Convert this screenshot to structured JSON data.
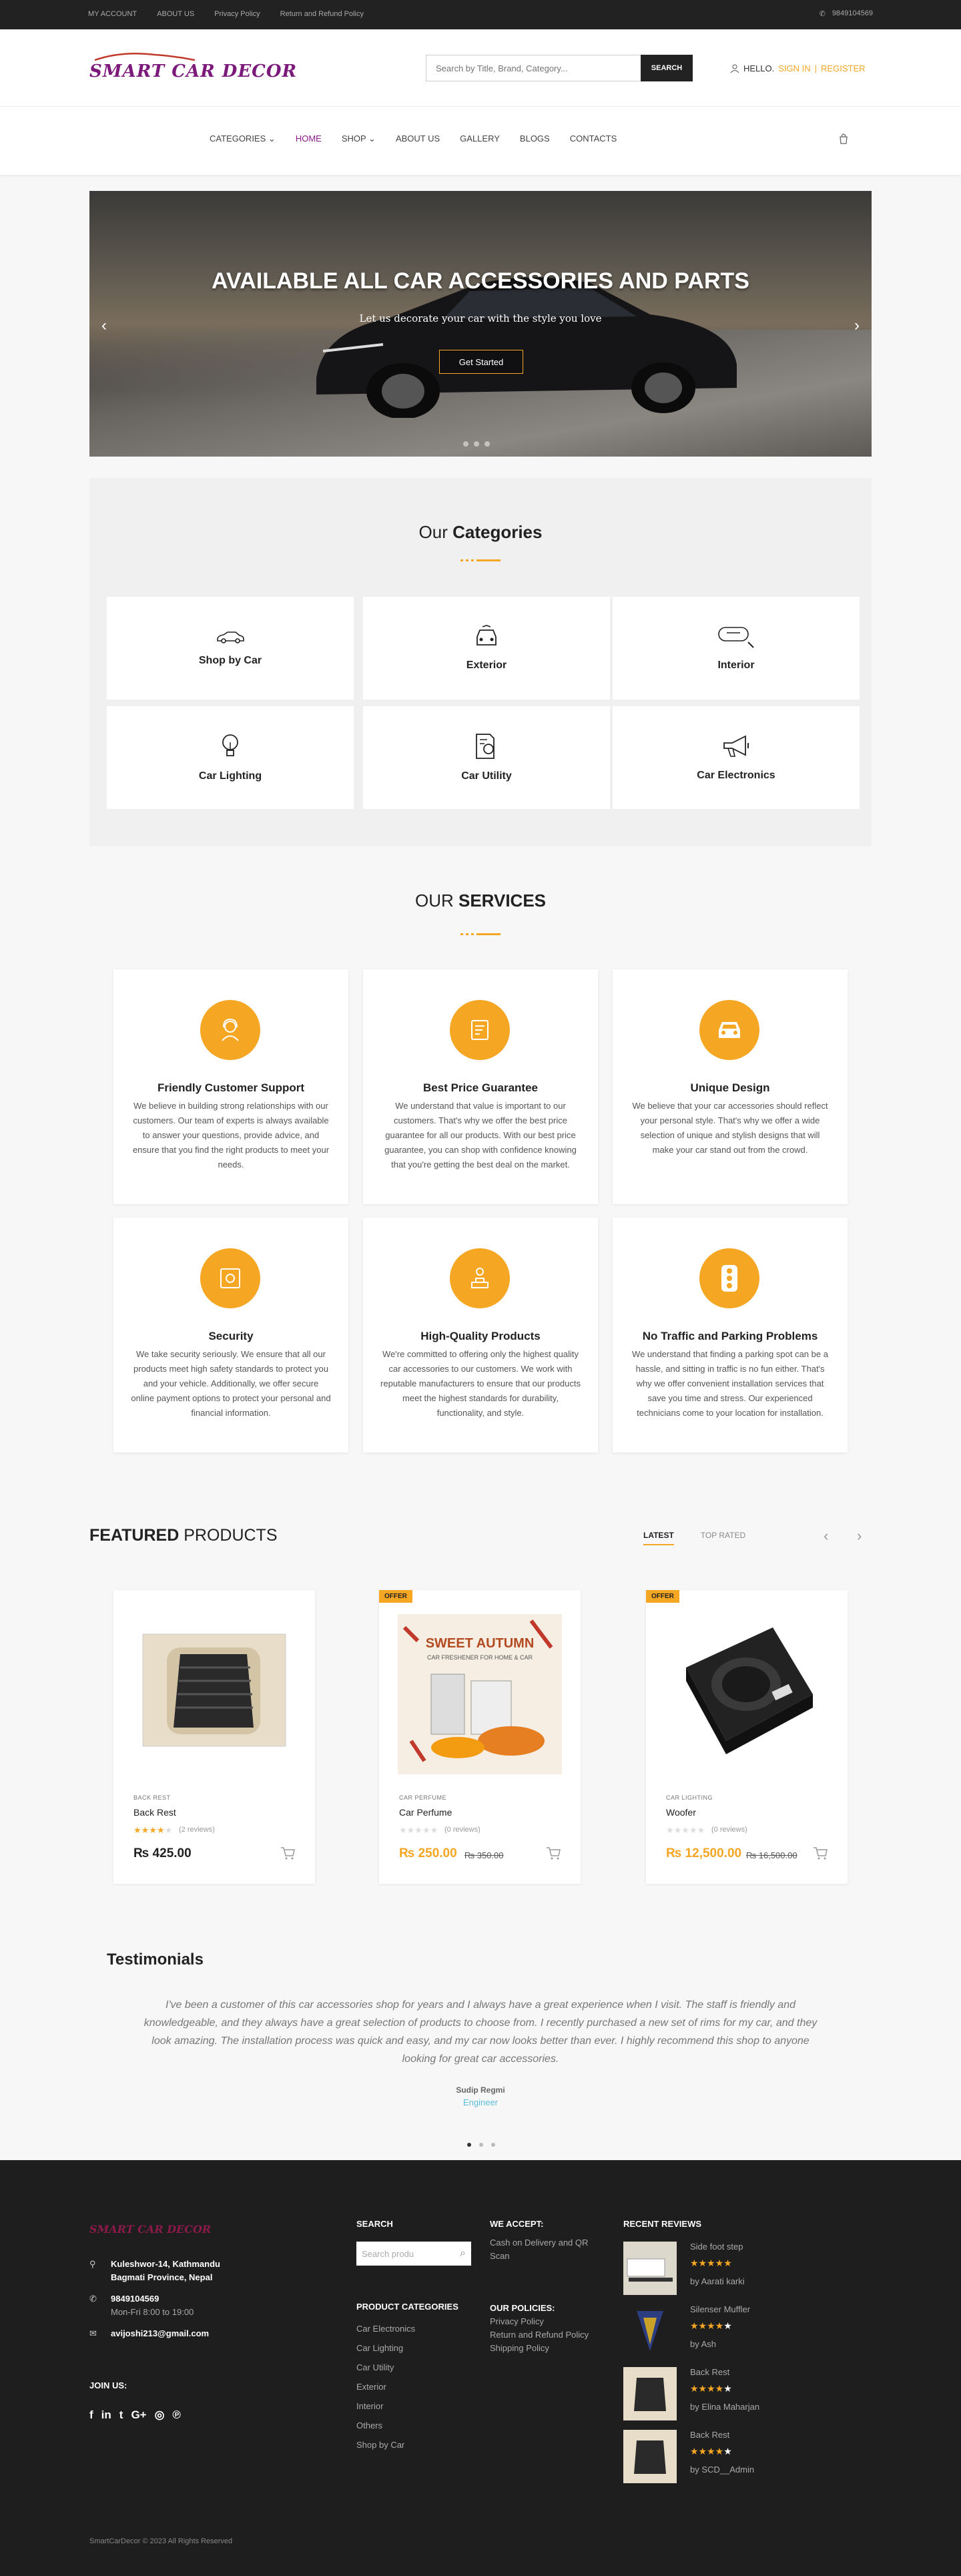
{
  "topbar": {
    "links": [
      "MY ACCOUNT",
      "ABOUT US",
      "Privacy Policy",
      "Return and Refund Policy"
    ],
    "phone": "9849104569"
  },
  "header": {
    "logo": "SMART CAR DECOR",
    "search_placeholder": "Search by Title, Brand, Category...",
    "search_button": "SEARCH",
    "hello": "HELLO.",
    "signin": "SIGN IN",
    "sep": "|",
    "register": "REGISTER"
  },
  "nav": {
    "items": [
      "CATEGORIES",
      "HOME",
      "SHOP",
      "ABOUT US",
      "GALLERY",
      "BLOGS",
      "CONTACTS"
    ],
    "active": "HOME"
  },
  "hero": {
    "title": "AVAILABLE ALL CAR ACCESSORIES AND PARTS",
    "subtitle": "Let us decorate your car with the style you love",
    "cta": "Get Started",
    "prev": "‹",
    "next": "›"
  },
  "categories": {
    "title_a": "Our",
    "title_b": "Categories",
    "items": [
      "Shop by Car",
      "Exterior",
      "Interior",
      "Car Lighting",
      "Car Utility",
      "Car Electronics"
    ]
  },
  "services": {
    "title_a": "OUR",
    "title_b": "SERVICES",
    "items": [
      {
        "title": "Friendly Customer Support",
        "text": "We believe in building strong relationships with our customers. Our team of experts is always available to answer your questions, provide advice, and ensure that you find the right products to meet your needs."
      },
      {
        "title": "Best Price Guarantee",
        "text": "We understand that value is important to our customers. That's why we offer the best price guarantee for all our products. With our best price guarantee, you can shop with confidence knowing that you're getting the best deal on the market."
      },
      {
        "title": "Unique Design",
        "text": "We believe that your car accessories should reflect your personal style. That's why we offer a wide selection of unique and stylish designs that will make your car stand out from the crowd."
      },
      {
        "title": "Security",
        "text": "We take security seriously. We ensure that all our products meet high safety standards to protect you and your vehicle. Additionally, we offer secure online payment options to protect your personal and financial information."
      },
      {
        "title": "High-Quality Products",
        "text": "We're committed to offering only the highest quality car accessories to our customers. We work with reputable manufacturers to ensure that our products meet the highest standards for durability, functionality, and style."
      },
      {
        "title": "No Traffic and Parking Problems",
        "text": "We understand that finding a parking spot can be a hassle, and sitting in traffic is no fun either. That's why we offer convenient installation services that save you time and stress. Our experienced technicians come to your location for installation."
      }
    ]
  },
  "featured": {
    "title_a": "FEATURED",
    "title_b": "PRODUCTS",
    "tabs": [
      "LATEST",
      "TOP RATED"
    ],
    "prev": "‹",
    "next": "›",
    "products": [
      {
        "category": "BACK REST",
        "name": "Back Rest",
        "rating": 4,
        "reviews": "(2 reviews)",
        "price": "₨ 425.00",
        "old": "",
        "offer": ""
      },
      {
        "category": "CAR PERFUME",
        "name": "Car Perfume",
        "rating": 0,
        "reviews": "(0 reviews)",
        "price": "₨ 250.00",
        "old": "₨ 350.00",
        "offer": "OFFER",
        "img_title": "SWEET AUTUMN",
        "img_sub": "CAR FRESHENER FOR HOME & CAR"
      },
      {
        "category": "CAR LIGHTING",
        "name": "Woofer",
        "rating": 0,
        "reviews": "(0 reviews)",
        "price": "₨ 12,500.00",
        "old": "₨ 16,500.00",
        "offer": "OFFER"
      }
    ]
  },
  "testimonials": {
    "title": "Testimonials",
    "quote": "I've been a customer of this car accessories shop for years and I always have a great experience when I visit. The staff is friendly and knowledgeable, and they always have a great selection of products to choose from. I recently purchased a new set of rims for my car, and they look amazing. The installation process was quick and easy, and my car now looks better than ever. I highly recommend this shop to anyone looking for great car accessories.",
    "author": "Sudip Regmi",
    "role": "Engineer"
  },
  "footer": {
    "logo": "SMART CAR DECOR",
    "address1": "Kuleshwor-14, Kathmandu",
    "address2": "Bagmati Province, Nepal",
    "phone": "9849104569",
    "hours": "Mon-Fri 8:00 to 19:00",
    "email": "avijoshi213@gmail.com",
    "join": "JOIN US:",
    "social": [
      "f",
      "in",
      "t",
      "G+",
      "◎",
      "℗"
    ],
    "search_h": "SEARCH",
    "search_placeholder": "Search produ",
    "pc_h": "PRODUCT CATEGORIES",
    "pc": [
      "Car Electronics",
      "Car Lighting",
      "Car Utility",
      "Exterior",
      "Interior",
      "Others",
      "Shop by Car"
    ],
    "accept_h": "WE ACCEPT:",
    "accept": [
      "Cash on Delivery and QR",
      "Scan"
    ],
    "policies_h": "OUR POLICIES:",
    "policies": [
      "Privacy Policy",
      "Return and Refund Policy",
      "Shipping Policy"
    ],
    "reviews_h": "RECENT REVIEWS",
    "reviews": [
      {
        "t": "Side foot step",
        "by": "by Aarati karki",
        "rating": 5
      },
      {
        "t": "Silenser Muffler",
        "by": "by Ash",
        "rating": 4
      },
      {
        "t": "Back Rest",
        "by": "by Elina Maharjan",
        "rating": 4
      },
      {
        "t": "Back Rest",
        "by": "by SCD__Admin",
        "rating": 4
      }
    ],
    "copy": "SmartCarDecor © 2023 All Rights Reserved"
  },
  "colors": {
    "accent": "#f5a623",
    "brand": "#7b1a7a",
    "dark": "#222222"
  }
}
